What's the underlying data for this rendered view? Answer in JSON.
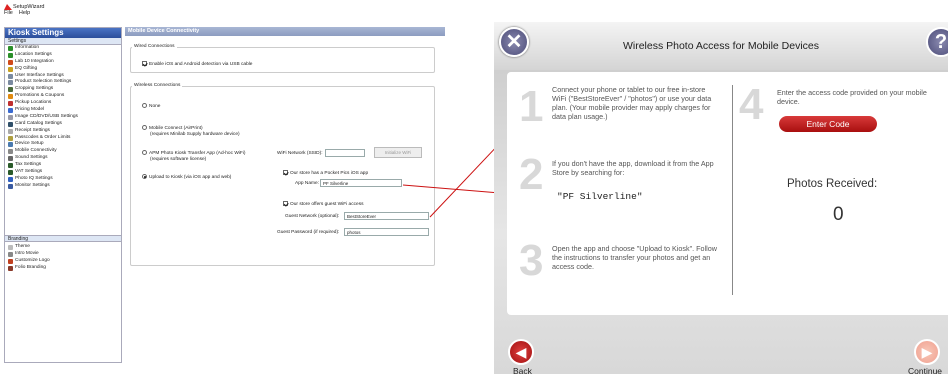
{
  "window": {
    "title": "SetupWizard",
    "menu": [
      "File",
      "Help"
    ]
  },
  "sidebar": {
    "title": "Kiosk Settings",
    "section": "Settings",
    "items": [
      {
        "label": "Information",
        "icon": "info-icon",
        "color": "#2a8f2a"
      },
      {
        "label": "Location Settings",
        "icon": "location-icon",
        "color": "#2a8f2a"
      },
      {
        "label": "Lab 10 Integration",
        "icon": "lab-icon",
        "color": "#d04a1a"
      },
      {
        "label": "EQ Gifting",
        "icon": "gift-icon",
        "color": "#c8a020"
      },
      {
        "label": "User Interface Settings",
        "icon": "ui-icon",
        "color": "#7a8aa0"
      },
      {
        "label": "Product Selection Settings",
        "icon": "product-icon",
        "color": "#7a8aa0"
      },
      {
        "label": "Cropping Settings",
        "icon": "crop-icon",
        "color": "#4a6a3a"
      },
      {
        "label": "Promotions & Coupons",
        "icon": "promo-icon",
        "color": "#e08a10"
      },
      {
        "label": "Pickup Locations",
        "icon": "pickup-icon",
        "color": "#c03030"
      },
      {
        "label": "Pricing Model",
        "icon": "pricing-icon",
        "color": "#3a6ad0"
      },
      {
        "label": "Image CD/DVD/USB Settings",
        "icon": "disc-icon",
        "color": "#9a9aa8"
      },
      {
        "label": "Card Catalog Settings",
        "icon": "catalog-icon",
        "color": "#30506a"
      },
      {
        "label": "Receipt Settings",
        "icon": "receipt-icon",
        "color": "#aaaaaa"
      },
      {
        "label": "Passcodes & Order Limits",
        "icon": "passcode-icon",
        "color": "#b0a040"
      },
      {
        "label": "Device Setup",
        "icon": "device-icon",
        "color": "#4a7ab0"
      },
      {
        "label": "Mobile Connectivity",
        "icon": "mobile-icon",
        "color": "#888888"
      },
      {
        "label": "Sound Settings",
        "icon": "sound-icon",
        "color": "#666666"
      },
      {
        "label": "Tax Settings",
        "icon": "tax-icon",
        "color": "#2a5a2a"
      },
      {
        "label": "VAT Settings",
        "icon": "vat-icon",
        "color": "#2a5a2a"
      },
      {
        "label": "Photo IQ Settings",
        "icon": "photoiq-icon",
        "color": "#3060c0"
      },
      {
        "label": "Monitor Settings",
        "icon": "monitor-icon",
        "color": "#3a5aa0"
      }
    ],
    "branding_section": "Branding",
    "branding_items": [
      {
        "label": "Theme",
        "icon": "theme-icon",
        "color": "#bbbbbb"
      },
      {
        "label": "Intro Movie",
        "icon": "movie-icon",
        "color": "#888888"
      },
      {
        "label": "Customize Logo",
        "icon": "logo-icon",
        "color": "#c04020"
      },
      {
        "label": "Folio Branding",
        "icon": "folio-icon",
        "color": "#8a3a2a"
      }
    ]
  },
  "main": {
    "title": "Mobile Device Connectivity",
    "wired": {
      "label": "Wired Connections",
      "option": "Enable iOS and Android detection via USB cable"
    },
    "wireless": {
      "label": "Wireless Connections",
      "none": "None",
      "mobile_connect": "Mobile Connect (AirPrint)",
      "mobile_connect_sub": "(requires Minilab Supply hardware device)",
      "apm": "APM Photo Kiosk Transfer App (Ad-hoc WiFi)",
      "apm_sub": "(requires software license)",
      "upload": "Upload to Kiosk (via iOS app and web)",
      "wifi_ssid_label": "WiFi Network (SSID):",
      "wifi_ssid_value": "",
      "initialize_btn": "Initialize WiFi",
      "pocket_pics": "Our store has a Pocket Pics iOS app",
      "app_name_label": "App Name:",
      "app_name_value": "PF Silverline",
      "guest_wifi": "Our store offers guest WiFi access",
      "guest_network_label": "Guest Network (optional):",
      "guest_network_value": "BestStoreEver",
      "guest_password_label": "Guest Password (if required):",
      "guest_password_value": "photos"
    }
  },
  "ipad": {
    "title": "Wireless Photo Access for Mobile Devices",
    "step1": "Connect your phone or tablet to our free in-store WiFi (\"BestStoreEver\" / \"photos\") or use your data plan. (Your mobile provider may apply charges for data plan usage.)",
    "step2": "If you don't have the app, download it from the App Store by searching for:",
    "app_search": "\"PF Silverline\"",
    "step3": "Open the app and choose \"Upload to Kiosk\". Follow the instructions to transfer your photos and get an access code.",
    "step4": "Enter the access code provided on your mobile device.",
    "enter_code": "Enter Code",
    "photos_received_label": "Photos Received:",
    "photos_received_count": "0",
    "back": "Back",
    "continue": "Continue",
    "num1": "1",
    "num2": "2",
    "num3": "3",
    "num4": "4"
  },
  "colors": {
    "accent": "#2b4e9b",
    "red": "#c01818",
    "arrow": "#cc1111"
  }
}
